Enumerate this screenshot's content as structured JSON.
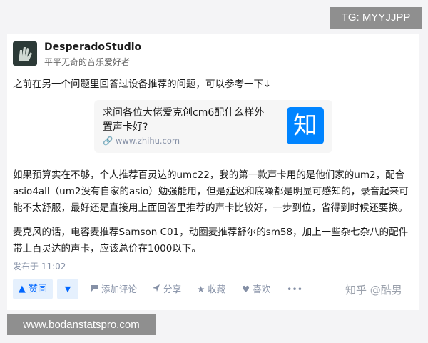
{
  "overlay": {
    "tg_label": "TG: MYYJJPP",
    "site_url": "www.bodanstatspro.com"
  },
  "author": {
    "name": "DesperadoStudio",
    "bio": "平平无奇的音乐爱好者"
  },
  "post": {
    "intro": "之前在另一个问题里回答过设备推荐的问题，可以参考一下↓",
    "linked_question": {
      "title": "求问各位大佬爱克创cm6配什么样外置声卡好?",
      "url": "www.zhihu.com",
      "logo_char": "知"
    },
    "paragraph1": "如果预算实在不够，个人推荐百灵达的umc22，我的第一款声卡用的是他们家的um2，配合asio4all（um2没有自家的asio）勉强能用，但是延迟和底噪都是明显可感知的，录音起来可能不太舒服，最好还是直接用上面回答里推荐的声卡比较好，一步到位，省得到时候还要换。",
    "paragraph2": "麦克风的话，电容麦推荐Samson C01，动圈麦推荐舒尔的sm58，加上一些杂七杂八的配件带上百灵达的声卡，应该总价在1000以下。",
    "posted_time": "发布于 11:02"
  },
  "actions": {
    "upvote": "▲ 赞同",
    "downvote": "▼",
    "comment": "添加评论",
    "share": "分享",
    "favorite": "收藏",
    "like": "喜欢",
    "more": "•••"
  },
  "watermark": "知乎 @酷男",
  "colors": {
    "zhihu_blue": "#0084ff",
    "vote_bg": "#e5f0fd",
    "vote_text": "#0066ff",
    "meta_gray": "#8590a6"
  }
}
